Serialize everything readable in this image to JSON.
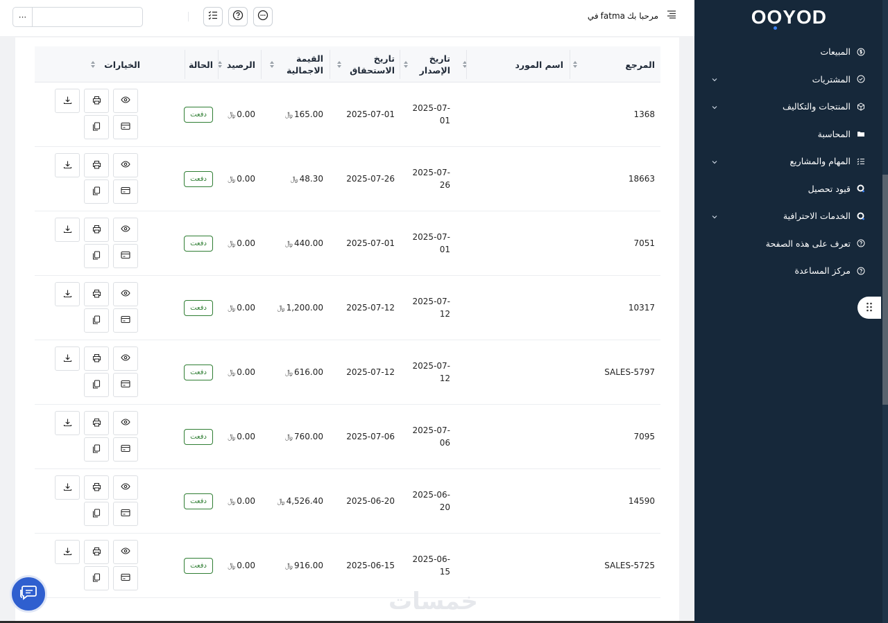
{
  "header": {
    "welcome_prefix": "مرحبا بك",
    "user_name": "fatma",
    "welcome_suffix": "في",
    "more_label": "···"
  },
  "sidebar": {
    "logo": "OOYOD",
    "items": [
      {
        "label": "المبيعات",
        "icon": "dollar-circle-icon",
        "has_chevron": false
      },
      {
        "label": "المشتريات",
        "icon": "receipt-icon",
        "has_chevron": true
      },
      {
        "label": "المنتجات والتكاليف",
        "icon": "box-icon",
        "has_chevron": true
      },
      {
        "label": "المحاسبة",
        "icon": "folder-icon",
        "has_chevron": false
      },
      {
        "label": "المهام والمشاريع",
        "icon": "tasks-icon",
        "has_chevron": true
      },
      {
        "label": "قيود تحصيل",
        "icon": "ooyod-dot-icon",
        "has_chevron": false
      },
      {
        "label": "الخدمات الاحترافية",
        "icon": "ooyod-dot-icon",
        "has_chevron": true
      },
      {
        "label": "تعرف على هذه الصفحة",
        "icon": "help-circle-icon",
        "has_chevron": false
      },
      {
        "label": "مركز المساعدة",
        "icon": "help-circle-icon",
        "has_chevron": false
      }
    ]
  },
  "table": {
    "columns": {
      "ref": "المرجع",
      "supplier": "اسم المورد",
      "issue_date": "تاريخ الإصدار",
      "due_date": "تاريخ الاستحقاق",
      "total": "القيمة الاجمالية",
      "balance": "الرصيد",
      "status": "الحالة",
      "options": "الخيارات"
    },
    "currency_symbol": "﷼",
    "rows": [
      {
        "ref": "1368",
        "issue_a": "2025-07-",
        "issue_b": "01",
        "due": "2025-07-01",
        "total": "165.00",
        "balance": "0.00",
        "status": "دفعت"
      },
      {
        "ref": "18663",
        "issue_a": "2025-07-",
        "issue_b": "26",
        "due": "2025-07-26",
        "total": "48.30",
        "balance": "0.00",
        "status": "دفعت"
      },
      {
        "ref": "7051",
        "issue_a": "2025-07-",
        "issue_b": "01",
        "due": "2025-07-01",
        "total": "440.00",
        "balance": "0.00",
        "status": "دفعت"
      },
      {
        "ref": "10317",
        "issue_a": "2025-07-",
        "issue_b": "12",
        "due": "2025-07-12",
        "total": "1,200.00",
        "balance": "0.00",
        "status": "دفعت"
      },
      {
        "ref": "SALES-5797",
        "issue_a": "2025-07-",
        "issue_b": "12",
        "due": "2025-07-12",
        "total": "616.00",
        "balance": "0.00",
        "status": "دفعت"
      },
      {
        "ref": "7095",
        "issue_a": "2025-07-",
        "issue_b": "06",
        "due": "2025-07-06",
        "total": "760.00",
        "balance": "0.00",
        "status": "دفعت"
      },
      {
        "ref": "14590",
        "issue_a": "2025-06-",
        "issue_b": "20",
        "due": "2025-06-20",
        "total": "4,526.40",
        "balance": "0.00",
        "status": "دفعت"
      },
      {
        "ref": "SALES-5725",
        "issue_a": "2025-06-",
        "issue_b": "15",
        "due": "2025-06-15",
        "total": "916.00",
        "balance": "0.00",
        "status": "دفعت"
      }
    ]
  },
  "watermark": "خمسات"
}
